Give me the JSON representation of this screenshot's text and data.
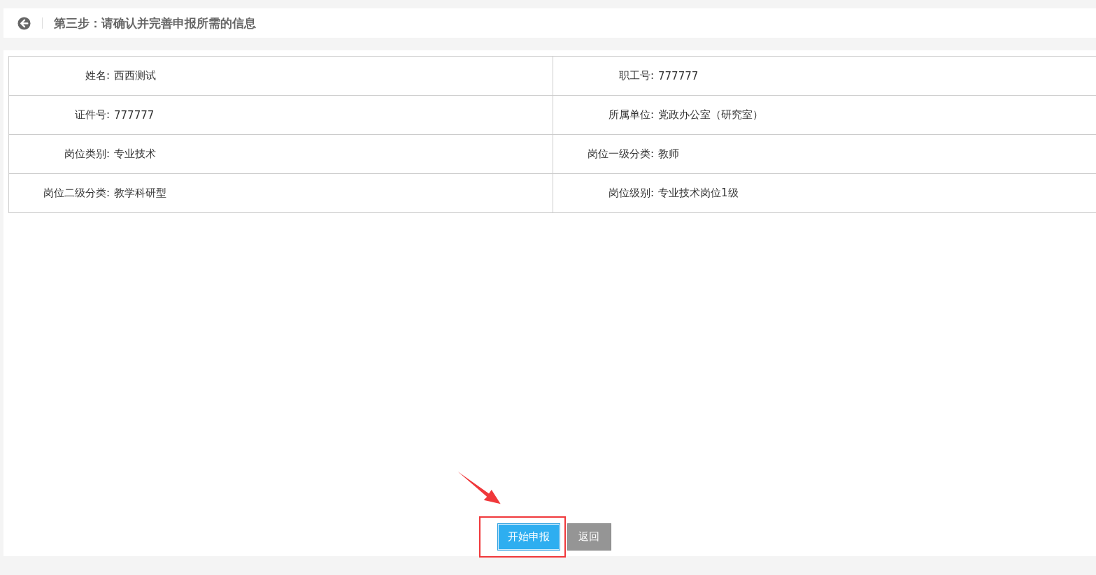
{
  "header": {
    "title": "第三步：请确认并完善申报所需的信息"
  },
  "info_rows": [
    [
      {
        "label": "姓名:",
        "value": "西西测试"
      },
      {
        "label": "职工号:",
        "value": "777777"
      }
    ],
    [
      {
        "label": "证件号:",
        "value": "777777"
      },
      {
        "label": "所属单位:",
        "value": "党政办公室（研究室）"
      }
    ],
    [
      {
        "label": "岗位类别:",
        "value": "专业技术"
      },
      {
        "label": "岗位一级分类:",
        "value": "教师"
      }
    ],
    [
      {
        "label": "岗位二级分类:",
        "value": "教学科研型"
      },
      {
        "label": "岗位级别:",
        "value": "专业技术岗位1级"
      }
    ]
  ],
  "buttons": [
    {
      "label": "开始申报",
      "kind": "primary",
      "highlighted": true
    },
    {
      "label": "返回",
      "kind": "default",
      "highlighted": false
    }
  ]
}
